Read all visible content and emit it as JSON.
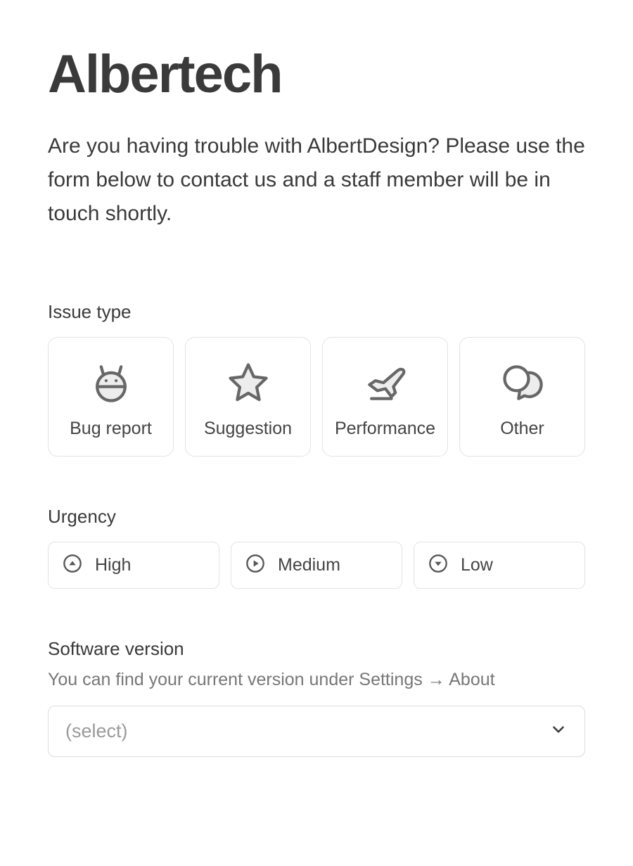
{
  "page_title": "Albertech",
  "subtitle": "Are you having trouble with AlbertDesign? Please use the form below to contact us and a staff member will be in touch shortly.",
  "issue_type": {
    "heading": "Issue type",
    "options": [
      {
        "label": "Bug report",
        "icon": "bug-icon"
      },
      {
        "label": "Suggestion",
        "icon": "star-icon"
      },
      {
        "label": "Performance",
        "icon": "plane-icon"
      },
      {
        "label": "Other",
        "icon": "chat-icon"
      }
    ]
  },
  "urgency": {
    "heading": "Urgency",
    "options": [
      {
        "label": "High",
        "icon": "circle-up-icon"
      },
      {
        "label": "Medium",
        "icon": "circle-play-icon"
      },
      {
        "label": "Low",
        "icon": "circle-down-icon"
      }
    ]
  },
  "software_version": {
    "heading": "Software version",
    "hint": "You can find your current version under Settings → About",
    "placeholder": "(select)"
  }
}
